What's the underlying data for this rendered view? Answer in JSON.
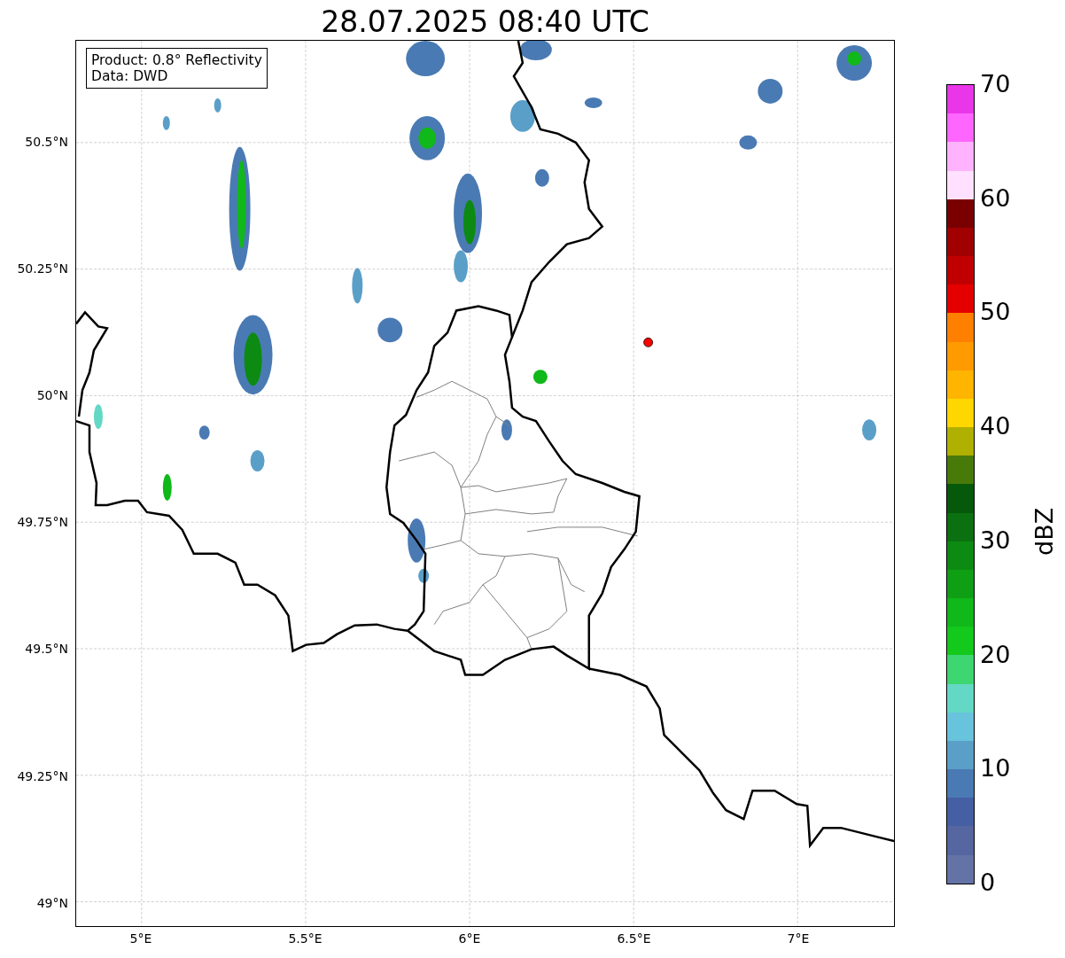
{
  "title": "28.07.2025 08:40 UTC",
  "info_box": [
    "Product: 0.8° Reflectivity",
    "Data: DWD"
  ],
  "y_ticks": [
    "50.5°N",
    "50.25°N",
    "50°N",
    "49.75°N",
    "49.5°N",
    "49.25°N",
    "49°N"
  ],
  "x_ticks": [
    "5°E",
    "5.5°E",
    "6°E",
    "6.5°E",
    "7°E"
  ],
  "colorbar": {
    "label": "dBZ",
    "ticks": [
      "70",
      "60",
      "50",
      "40",
      "30",
      "20",
      "10",
      "0"
    ],
    "segments": [
      {
        "color": "#e936e9"
      },
      {
        "color": "#ff66ff"
      },
      {
        "color": "#ffb3ff"
      },
      {
        "color": "#ffe0ff"
      },
      {
        "color": "#7a0000"
      },
      {
        "color": "#a00000"
      },
      {
        "color": "#c00000"
      },
      {
        "color": "#e50000"
      },
      {
        "color": "#ff7f00"
      },
      {
        "color": "#ff9a00"
      },
      {
        "color": "#ffb400"
      },
      {
        "color": "#ffd700"
      },
      {
        "color": "#b0b000"
      },
      {
        "color": "#487a0a"
      },
      {
        "color": "#06590a"
      },
      {
        "color": "#0b7010"
      },
      {
        "color": "#0d8a12"
      },
      {
        "color": "#0f9f15"
      },
      {
        "color": "#10b81a"
      },
      {
        "color": "#13c91b"
      },
      {
        "color": "#3dd671"
      },
      {
        "color": "#63d8c4"
      },
      {
        "color": "#68c3dc"
      },
      {
        "color": "#5a9fc8"
      },
      {
        "color": "#4a7ab3"
      },
      {
        "color": "#445fa3"
      },
      {
        "color": "#5566a0"
      },
      {
        "color": "#6473a6"
      }
    ]
  }
}
